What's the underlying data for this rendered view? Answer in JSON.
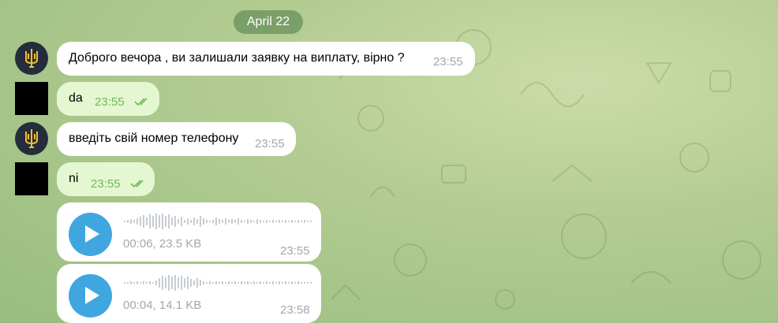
{
  "date_separator": "April 22",
  "messages": [
    {
      "text": "Доброго вечора , ви залишали заявку на виплату, вірно ?",
      "time": "23:55"
    },
    {
      "text": "da",
      "time": "23:55"
    },
    {
      "text": "введіть свій номер телефону",
      "time": "23:55"
    },
    {
      "text": "ni",
      "time": "23:55"
    }
  ],
  "voice_messages": [
    {
      "info": "00:06, 23.5 KB",
      "time": "23:55"
    },
    {
      "info": "00:04, 14.1 KB",
      "time": "23:58"
    }
  ],
  "colors": {
    "incoming_bubble": "#ffffff",
    "outgoing_bubble": "#e5f7d1",
    "play_button": "#40a6df",
    "date_pill": "#6a925c"
  }
}
